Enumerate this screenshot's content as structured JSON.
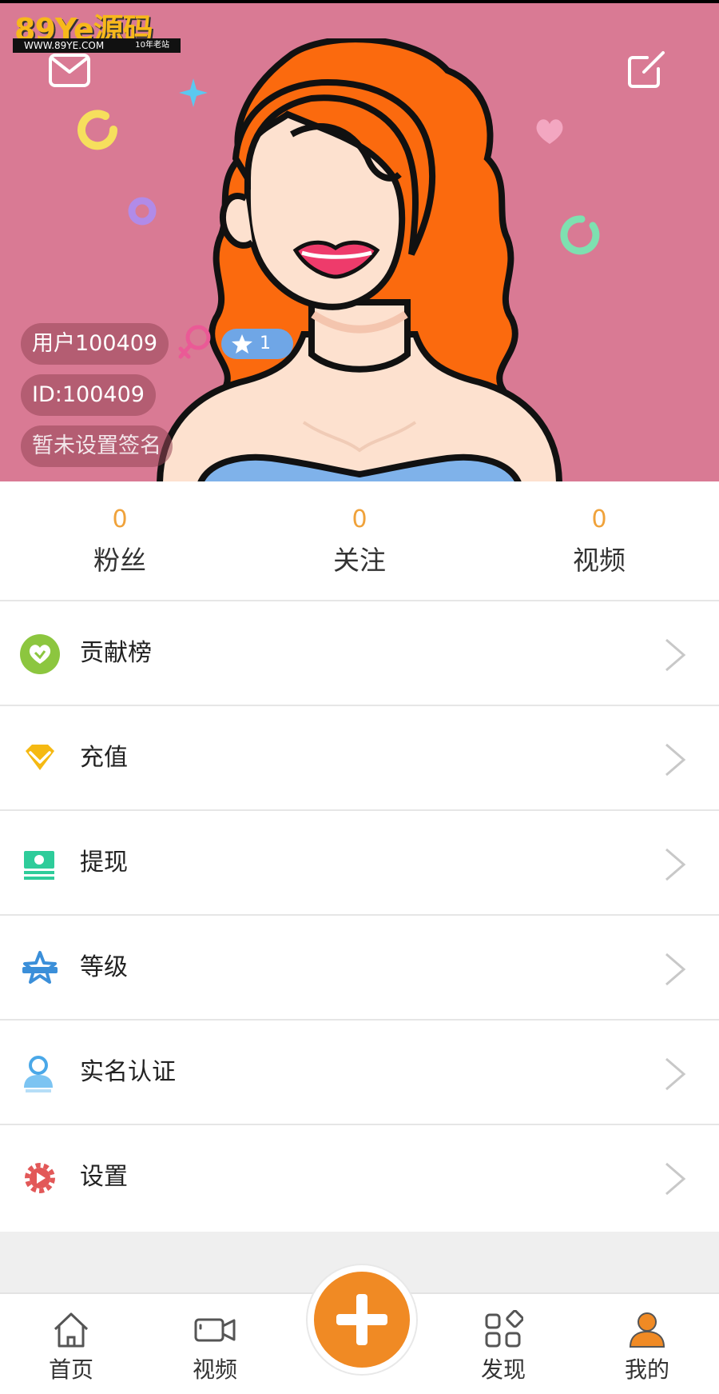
{
  "watermark": {
    "brand": "89Ye源码",
    "url": "WWW.89YE.COM",
    "tagline": "10年老站"
  },
  "profile": {
    "username": "用户100409",
    "id_text": "ID:100409",
    "signature": "暂未设置签名",
    "level": "1",
    "gender": "female",
    "header_bg_color": "#d97a94"
  },
  "stats": [
    {
      "value": "0",
      "label": "粉丝"
    },
    {
      "value": "0",
      "label": "关注"
    },
    {
      "value": "0",
      "label": "视频"
    }
  ],
  "menu": [
    {
      "label": "贡献榜",
      "icon": "heart-badge-icon",
      "color": "#8cc63f"
    },
    {
      "label": "充值",
      "icon": "diamond-icon",
      "color": "#f5b913"
    },
    {
      "label": "提现",
      "icon": "cash-icon",
      "color": "#2ecc9a"
    },
    {
      "label": "等级",
      "icon": "star-level-icon",
      "color": "#3b8fd9"
    },
    {
      "label": "实名认证",
      "icon": "person-verify-icon",
      "color": "#4aa8e8"
    },
    {
      "label": "设置",
      "icon": "gear-icon",
      "color": "#e25858"
    }
  ],
  "tabbar": {
    "home": "首页",
    "video": "视频",
    "discover": "发现",
    "mine": "我的",
    "accent": "#f08a24"
  }
}
